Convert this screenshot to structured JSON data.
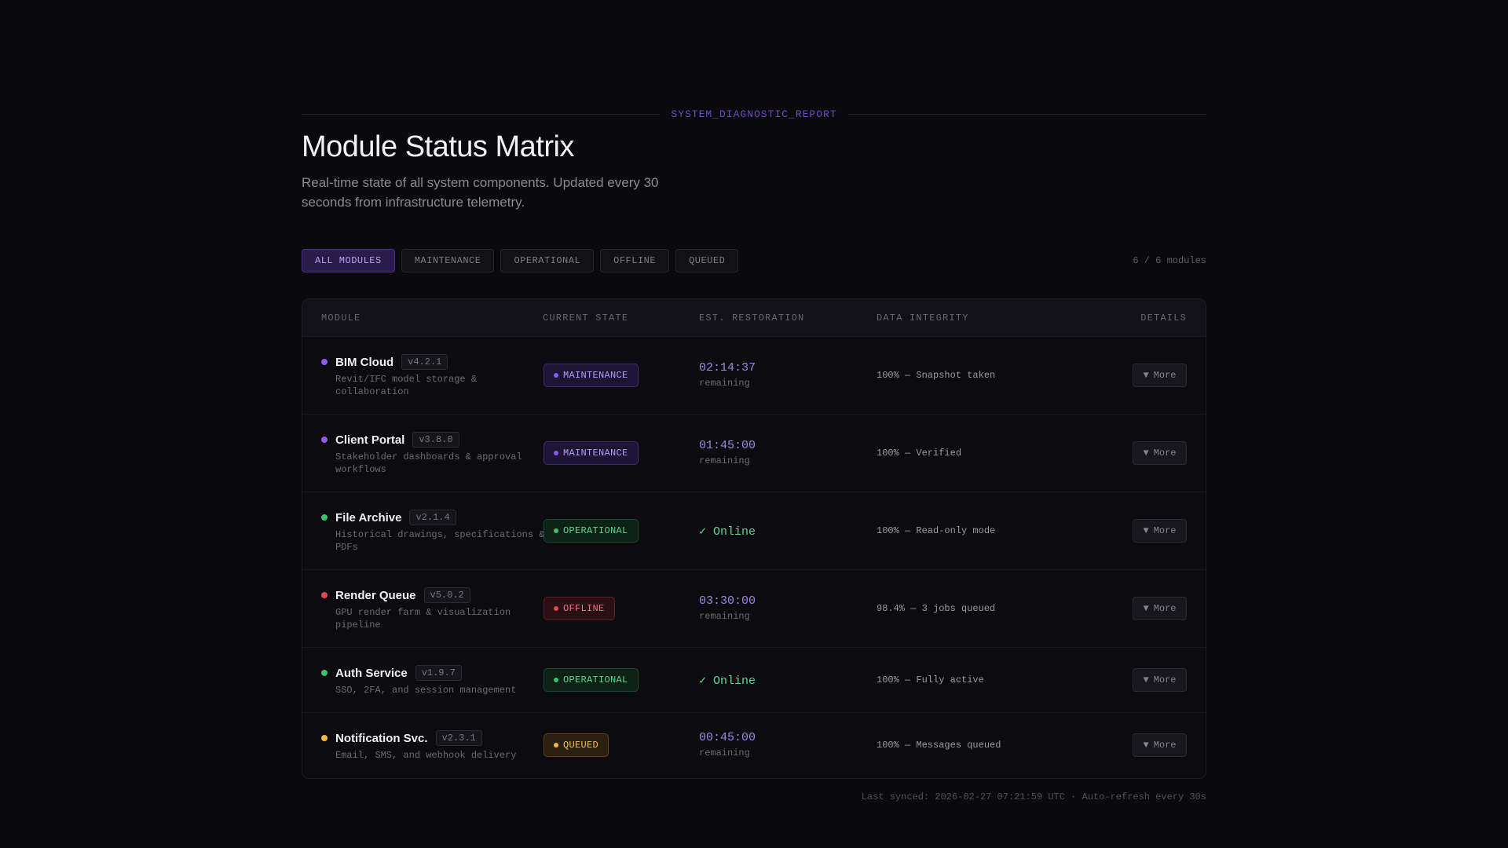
{
  "eyebrow": "SYSTEM_DIAGNOSTIC_REPORT",
  "title": "Module Status Matrix",
  "subtitle": "Real-time state of all system components. Updated every 30 seconds from infrastructure telemetry.",
  "filters": [
    "ALL MODULES",
    "MAINTENANCE",
    "OPERATIONAL",
    "OFFLINE",
    "QUEUED"
  ],
  "active_filter": "ALL MODULES",
  "count": "6 / 6 modules",
  "columns": {
    "module": "MODULE",
    "state": "CURRENT STATE",
    "restoration": "EST. RESTORATION",
    "integrity": "DATA INTEGRITY",
    "details": "DETAILS"
  },
  "more_label": "More",
  "remaining_label": "remaining",
  "colors": {
    "accent": "#8c5cf0",
    "operational": "#3cc26a",
    "offline": "#e5484d",
    "queued": "#f5b942"
  },
  "rows": [
    {
      "name": "BIM Cloud",
      "version": "v4.2.1",
      "desc": "Revit/IFC model storage & collaboration",
      "state": "MAINTENANCE",
      "restore": "02:14:37",
      "integrity": "100% — Snapshot taken"
    },
    {
      "name": "Client Portal",
      "version": "v3.8.0",
      "desc": "Stakeholder dashboards & approval workflows",
      "state": "MAINTENANCE",
      "restore": "01:45:00",
      "integrity": "100% — Verified"
    },
    {
      "name": "File Archive",
      "version": "v2.1.4",
      "desc": "Historical drawings, specifications & PDFs",
      "state": "OPERATIONAL",
      "restore": "✓ Online",
      "integrity": "100% — Read-only mode"
    },
    {
      "name": "Render Queue",
      "version": "v5.0.2",
      "desc": "GPU render farm & visualization pipeline",
      "state": "OFFLINE",
      "restore": "03:30:00",
      "integrity": "98.4% — 3 jobs queued"
    },
    {
      "name": "Auth Service",
      "version": "v1.9.7",
      "desc": "SSO, 2FA, and session management",
      "state": "OPERATIONAL",
      "restore": "✓ Online",
      "integrity": "100% — Fully active"
    },
    {
      "name": "Notification Svc.",
      "version": "v2.3.1",
      "desc": "Email, SMS, and webhook delivery",
      "state": "QUEUED",
      "restore": "00:45:00",
      "integrity": "100% — Messages queued"
    }
  ],
  "footer": "Last synced: 2026-02-27 07:21:59 UTC · Auto-refresh every 30s"
}
